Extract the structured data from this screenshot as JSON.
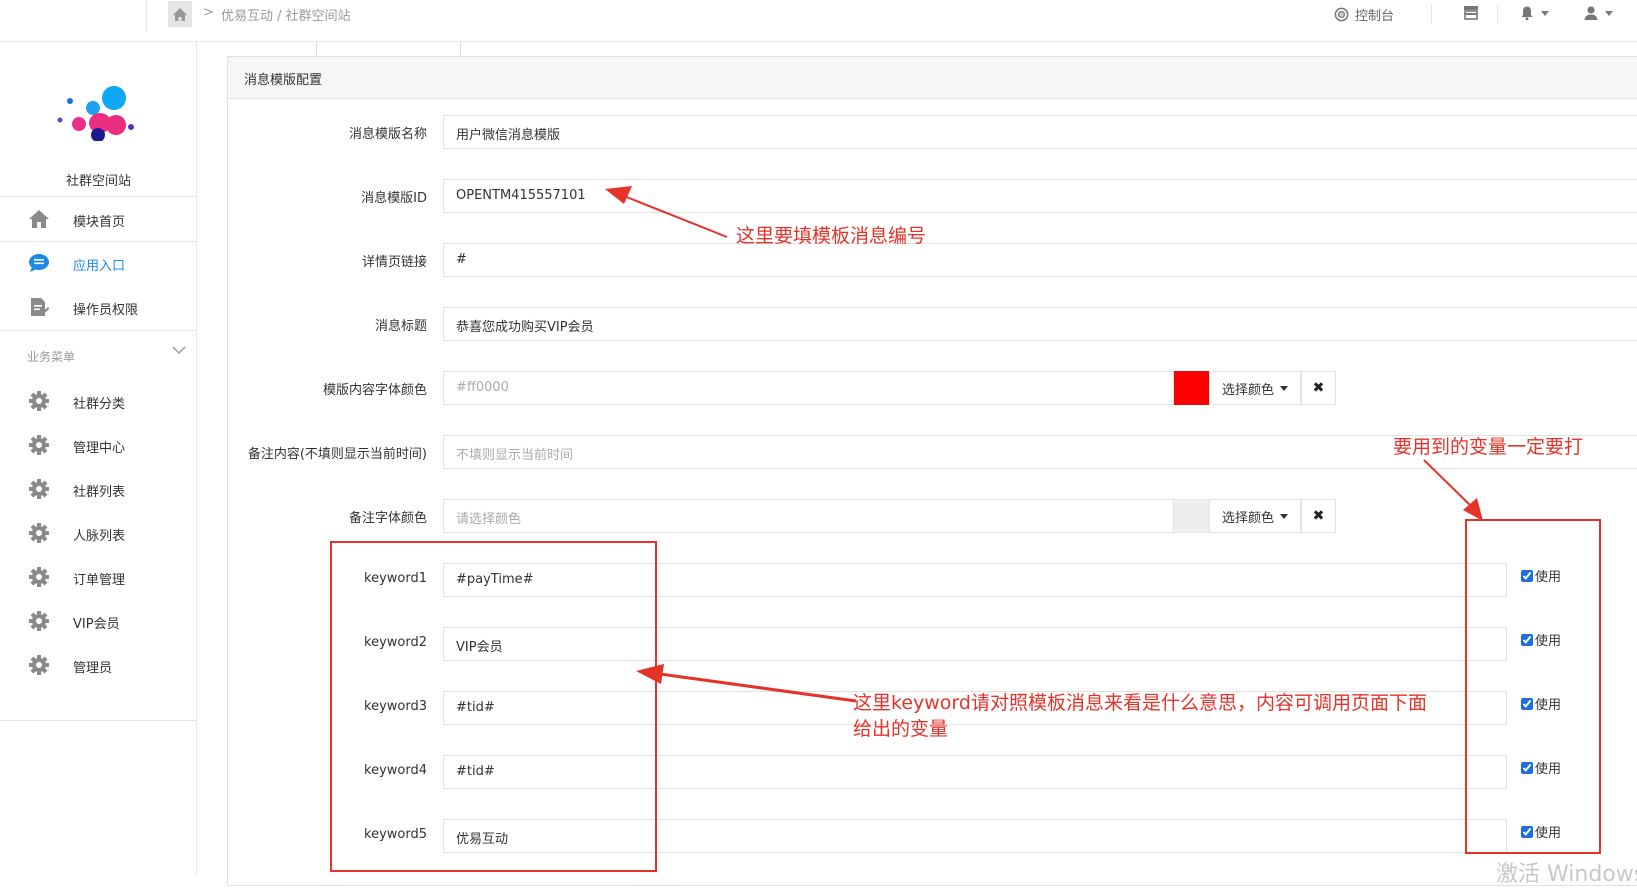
{
  "topbar": {
    "breadcrumb_sep": ">",
    "breadcrumb": "优易互动 / 社群空间站",
    "console_label": "控制台"
  },
  "sidebar": {
    "brand_name": "社群空间站",
    "items": [
      {
        "label": "模块首页",
        "icon": "home-icon"
      },
      {
        "label": "应用入口",
        "icon": "chat-icon",
        "active": true
      },
      {
        "label": "操作员权限",
        "icon": "edit-doc-icon"
      }
    ],
    "group_title": "业务菜单",
    "group_items": [
      {
        "label": "社群分类"
      },
      {
        "label": "管理中心"
      },
      {
        "label": "社群列表"
      },
      {
        "label": "人脉列表"
      },
      {
        "label": "订单管理"
      },
      {
        "label": "VIP会员"
      },
      {
        "label": "管理员"
      }
    ]
  },
  "panel": {
    "title": "消息模版配置"
  },
  "form": {
    "template_name": {
      "label": "消息模版名称",
      "value": "用户微信消息模版"
    },
    "template_id": {
      "label": "消息模版ID",
      "value": "OPENTM415557101"
    },
    "detail_link": {
      "label": "详情页链接",
      "value": "#"
    },
    "message_title": {
      "label": "消息标题",
      "value": "恭喜您成功购买VIP会员"
    },
    "content_color": {
      "label": "模版内容字体颜色",
      "value": "#ff0000",
      "swatch": "#ff0000",
      "button": "选择颜色",
      "clear": "✖"
    },
    "remark": {
      "label": "备注内容(不填则显示当前时间)",
      "placeholder": "不填则显示当前时间"
    },
    "remark_color": {
      "label": "备注字体颜色",
      "placeholder": "请选择颜色",
      "swatch": "#eeeeee",
      "button": "选择颜色",
      "clear": "✖"
    },
    "keywords": [
      {
        "label": "keyword1",
        "value": "#payTime#",
        "use_label": "使用",
        "checked": true
      },
      {
        "label": "keyword2",
        "value": "VIP会员",
        "use_label": "使用",
        "checked": true
      },
      {
        "label": "keyword3",
        "value": "#tid#",
        "use_label": "使用",
        "checked": true
      },
      {
        "label": "keyword4",
        "value": "#tid#",
        "use_label": "使用",
        "checked": true
      },
      {
        "label": "keyword5",
        "value": "优易互动",
        "use_label": "使用",
        "checked": true
      }
    ]
  },
  "annotations": {
    "template_id_note": "这里要填模板消息编号",
    "use_note": "要用到的变量一定要打",
    "keyword_note_line1": "这里keyword请对照模板消息来看是什么意思，内容可调用页面下面",
    "keyword_note_line2": "给出的变量",
    "color": "#e5332a"
  },
  "watermark": "激活 Windows"
}
